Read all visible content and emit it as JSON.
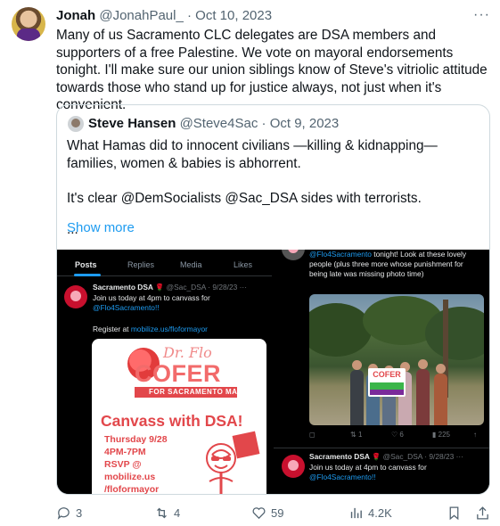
{
  "tweet": {
    "author_name": "Jonah",
    "author_handle": "@JonahPaul_",
    "separator": "·",
    "date": "Oct 10, 2023",
    "more": "···",
    "text": "Many of us Sacramento CLC delegates are DSA members and supporters of a free Palestine. We vote on mayoral endorsements tonight. I'll make sure our union siblings know of Steve's vitriolic attitude towards those who stand up for justice always, not just when it's convenient."
  },
  "quote": {
    "author_name": "Steve Hansen",
    "author_handle": "@Steve4Sac",
    "separator": "·",
    "date": "Oct 9, 2023",
    "paragraph1": "What Hamas did to innocent civilians —killing & kidnapping— families, women & babies is abhorrent.",
    "paragraph2": "It's clear @DemSocialists @Sac_DSA sides with terrorists.",
    "ellipsis": "...",
    "show_more": "Show more"
  },
  "media_left": {
    "tabs": [
      "Posts",
      "Replies",
      "Media",
      "Likes"
    ],
    "post": {
      "name": "Sacramento DSA",
      "badge": "🌹",
      "meta": "@Sac_DSA · 9/28/23 ···",
      "line1": "Join us today at 4pm to canvass for",
      "link": "@Flo4Sacramento!!",
      "register_prefix": "Register at",
      "register_link": "mobilize.us/floformayor"
    },
    "flyer": {
      "dr": "Dr. Flo",
      "cofer": "COFER",
      "mayor": "FOR SACRAMENTO MAYOR",
      "canvass": "Canvass with DSA!",
      "details": [
        "Thursday 9/28",
        "4PM-7PM",
        "RSVP @",
        "mobilize.us",
        "/floformayor"
      ]
    }
  },
  "media_right": {
    "top_text_link": "@Flo4Sacramento",
    "top_text": " tonight! Look at these lovely people (plus three more whose punishment for being late was missing photo time)",
    "sign_text": "COFER",
    "stats": {
      "comments": "",
      "reposts": "1",
      "likes": "6",
      "views": "225"
    },
    "post": {
      "name": "Sacramento DSA",
      "badge": "🌹",
      "meta": "@Sac_DSA · 9/28/23",
      "more": "···",
      "line1": "Join us today at 4pm to canvass for",
      "link": "@Flo4Sacramento!!"
    }
  },
  "actions": {
    "replies": "3",
    "reposts": "4",
    "likes": "59",
    "views": "4.2K"
  },
  "icons": [
    "reply-icon",
    "repost-icon",
    "like-icon",
    "views-icon",
    "bookmark-icon",
    "share-icon"
  ],
  "colors": {
    "link": "#1d9bf0",
    "text": "#0f1419",
    "secondary": "#536471",
    "flyer_red": "#e2474b"
  }
}
